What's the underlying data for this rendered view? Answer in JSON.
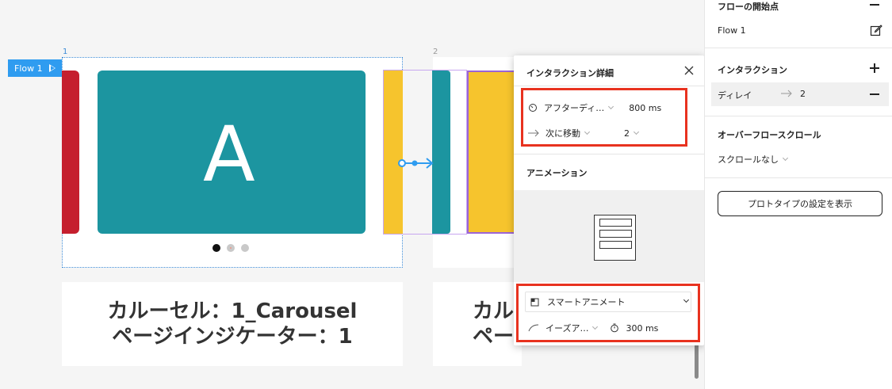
{
  "canvas": {
    "frame1_number": "1",
    "frame2_number": "2",
    "flow_tag": "Flow 1",
    "card_letter": "A",
    "label1_line1": "カルーセル：1_Carousel",
    "label1_line2": "ページインジケーター：1",
    "label2_line1": "カル",
    "label2_line2": "ペー"
  },
  "popup": {
    "title": "インタラクション詳細",
    "trigger": "アフターディ…",
    "delay": "800 ms",
    "action": "次に移動",
    "destination": "2",
    "animation_title": "アニメーション",
    "animation_type": "スマートアニメート",
    "easing": "イーズア…",
    "duration": "300 ms"
  },
  "panel": {
    "flow_start_title": "フローの開始点",
    "flow_name": "Flow 1",
    "interaction_title": "インタラクション",
    "interaction_trigger": "ディレイ",
    "interaction_destination": "2",
    "overflow_title": "オーバーフロースクロール",
    "overflow_value": "スクロールなし",
    "prototype_button": "プロトタイプの設定を表示"
  },
  "colors": {
    "teal": "#1c95a0",
    "red": "#c51f2e",
    "yellow": "#f6c42d",
    "highlight": "#e8321f",
    "flow_blue": "#2f9cf0",
    "selection_purple": "#9b64d6"
  }
}
